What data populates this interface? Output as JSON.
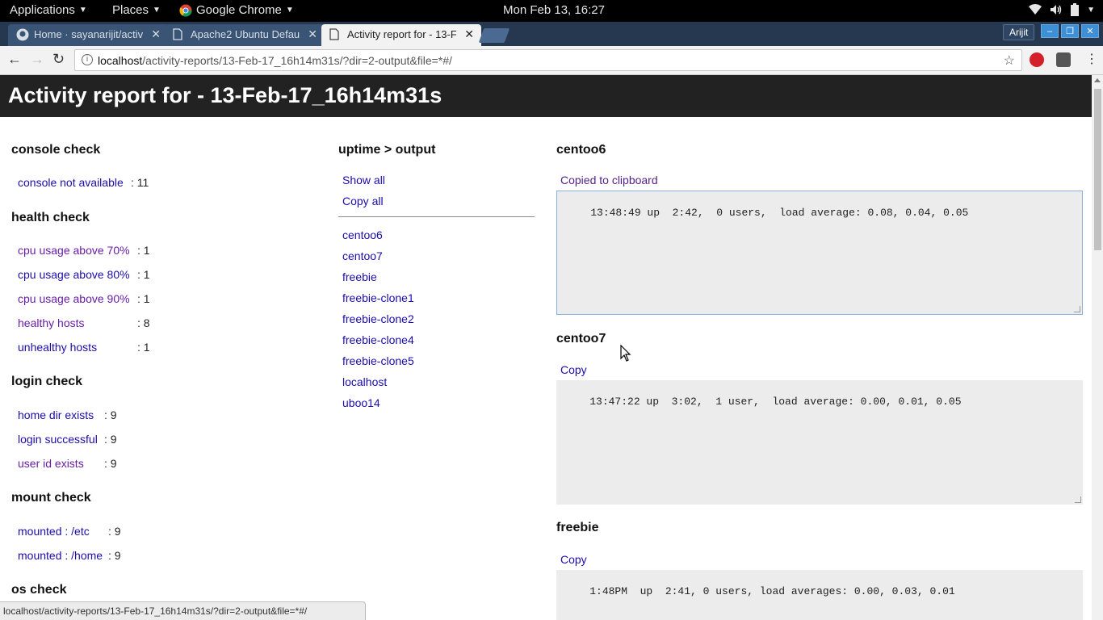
{
  "system_bar": {
    "applications": "Applications",
    "places": "Places",
    "app_name": "Google Chrome",
    "clock": "Mon Feb 13, 16:27"
  },
  "browser": {
    "tabs": [
      {
        "title": "Home · sayanarijit/activ"
      },
      {
        "title": "Apache2 Ubuntu Defau"
      },
      {
        "title": "Activity report for - 13-F"
      }
    ],
    "profile_name": "Arijit",
    "url_host": "localhost",
    "url_path": "/activity-reports/13-Feb-17_16h14m31s/?dir=2-output&file=*#/",
    "status_url": "localhost/activity-reports/13-Feb-17_16h14m31s/?dir=2-output&file=*#/"
  },
  "page": {
    "title": "Activity report for - 13-Feb-17_16h14m31s",
    "console": {
      "heading": "console check",
      "rows": [
        {
          "label": "console not available",
          "count": ": 11"
        }
      ]
    },
    "health": {
      "heading": "health check",
      "rows": [
        {
          "label": "cpu usage above 70%",
          "count": ": 1"
        },
        {
          "label": "cpu usage above 80%",
          "count": ": 1"
        },
        {
          "label": "cpu usage above 90%",
          "count": ": 1"
        },
        {
          "label": "healthy hosts",
          "count": ": 8"
        },
        {
          "label": "unhealthy hosts",
          "count": ": 1"
        }
      ]
    },
    "login": {
      "heading": "login check",
      "rows": [
        {
          "label": "home dir exists",
          "count": ": 9"
        },
        {
          "label": "login successful",
          "count": ": 9"
        },
        {
          "label": "user id exists",
          "count": ": 9"
        }
      ]
    },
    "mount": {
      "heading": "mount check",
      "rows": [
        {
          "label": "mounted : /etc",
          "count": ": 9"
        },
        {
          "label": "mounted : /home",
          "count": ": 9"
        }
      ]
    },
    "os": {
      "heading": "os check"
    },
    "uptime": {
      "heading": "uptime > output",
      "show_all": "Show all",
      "copy_all": "Copy all",
      "hosts": [
        "centoo6",
        "centoo7",
        "freebie",
        "freebie-clone1",
        "freebie-clone2",
        "freebie-clone4",
        "freebie-clone5",
        "localhost",
        "uboo14"
      ]
    },
    "outputs": [
      {
        "host": "centoo6",
        "copy_label": "Copied to clipboard",
        "text": "13:48:49 up  2:42,  0 users,  load average: 0.08, 0.04, 0.05"
      },
      {
        "host": "centoo7",
        "copy_label": "Copy",
        "text": "13:47:22 up  3:02,  1 user,  load average: 0.00, 0.01, 0.05"
      },
      {
        "host": "freebie",
        "copy_label": "Copy",
        "text": "1:48PM  up  2:41, 0 users, load averages: 0.00, 0.03, 0.01"
      }
    ]
  },
  "colors": {
    "link": "#1a0dab",
    "visited": "#681da8",
    "header_bg": "#222222",
    "output_bg": "#ececec"
  }
}
